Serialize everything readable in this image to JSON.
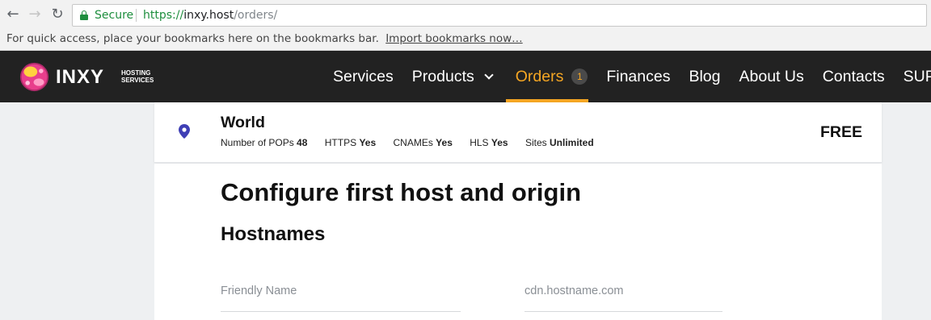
{
  "browser": {
    "secure_label": "Secure",
    "url_scheme": "https://",
    "url_host": "inxy.host",
    "url_path": "/orders/",
    "bookmarks_text": "For quick access, place your bookmarks here on the bookmarks bar.",
    "bookmarks_link": "Import bookmarks now…"
  },
  "header": {
    "logo_text": "INXY",
    "logo_sub": "HOSTING SERVICES",
    "menu": [
      {
        "label": "Services"
      },
      {
        "label": "Products"
      },
      {
        "label": "Orders",
        "badge": "1",
        "active": true
      },
      {
        "label": "Finances"
      },
      {
        "label": "Blog"
      },
      {
        "label": "About Us"
      },
      {
        "label": "Contacts"
      },
      {
        "label": "SUPPOR"
      }
    ]
  },
  "plan": {
    "name": "World",
    "price": "FREE",
    "attrs": [
      {
        "label": "Number of POPs",
        "value": "48"
      },
      {
        "label": "HTTPS",
        "value": "Yes"
      },
      {
        "label": "CNAMEs",
        "value": "Yes"
      },
      {
        "label": "HLS",
        "value": "Yes"
      },
      {
        "label": "Sites",
        "value": "Unlimited"
      }
    ]
  },
  "form": {
    "title": "Configure first host and origin",
    "section": "Hostnames",
    "friendly_name_placeholder": "Friendly Name",
    "hostname_placeholder": "cdn.hostname.com"
  },
  "colors": {
    "accent": "#f5a623",
    "header_bg": "#222222",
    "secure_green": "#1e8e3e",
    "pin": "#3f3fb5"
  }
}
